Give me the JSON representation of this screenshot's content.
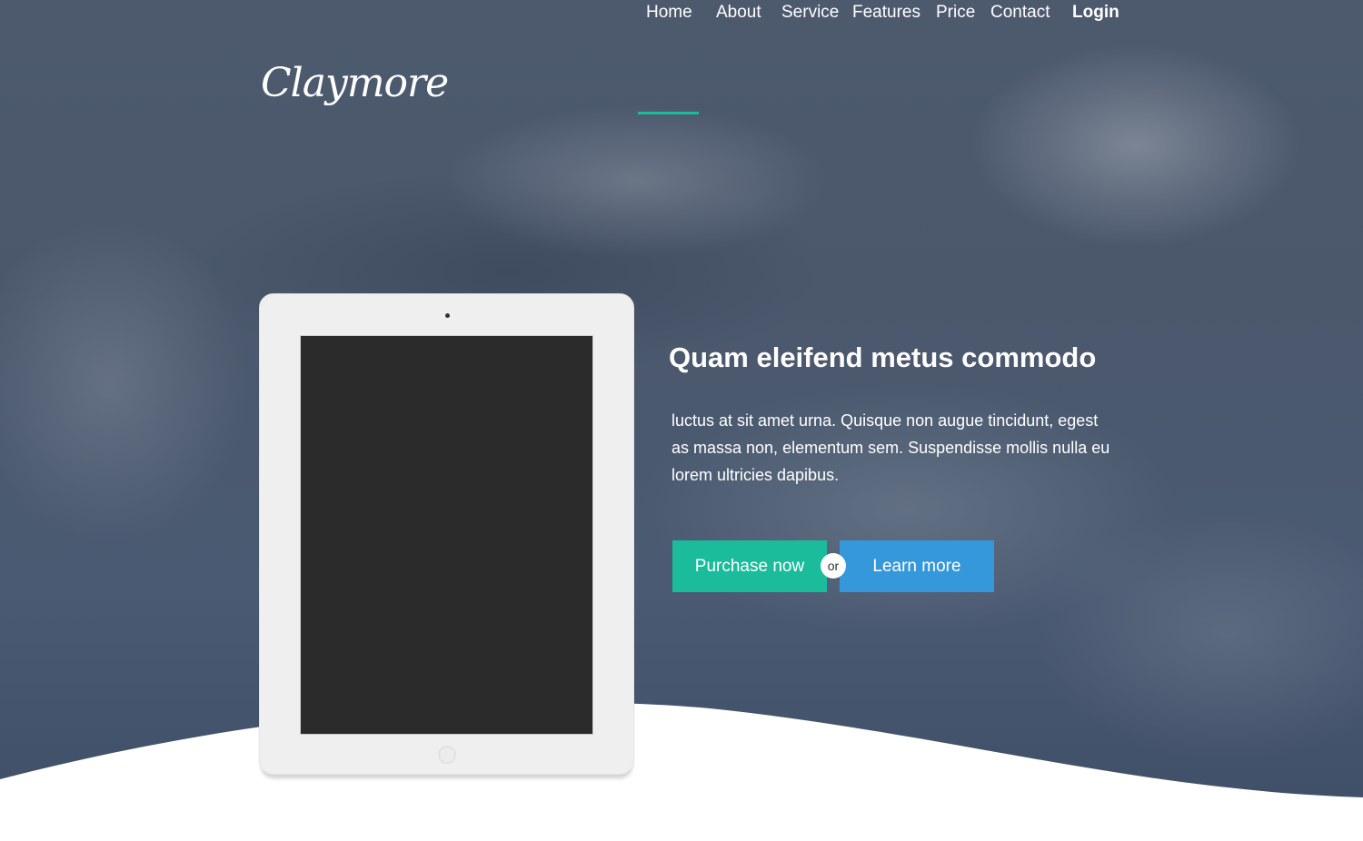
{
  "brand": {
    "logo_text": "Claymore"
  },
  "nav": {
    "items": [
      {
        "label": "Home",
        "active": true
      },
      {
        "label": "About"
      },
      {
        "label": "Service"
      },
      {
        "label": "Features"
      },
      {
        "label": "Price"
      },
      {
        "label": "Contact"
      }
    ],
    "login_label": "Login"
  },
  "hero": {
    "headline": "Quam eleifend metus commodo",
    "lead": "luctus at sit amet urna. Quisque non augue tincidunt, egest as massa non, elementum sem. Suspendisse mollis nulla eu lorem ultricies dapibus.",
    "purchase_label": "Purchase now",
    "or_label": "or",
    "learn_label": "Learn more"
  },
  "colors": {
    "accent_green": "#1abc9c",
    "accent_blue": "#3498db",
    "hero_overlay": "#4b586c",
    "device_body": "#efefef",
    "device_screen": "#2b2b2b"
  }
}
